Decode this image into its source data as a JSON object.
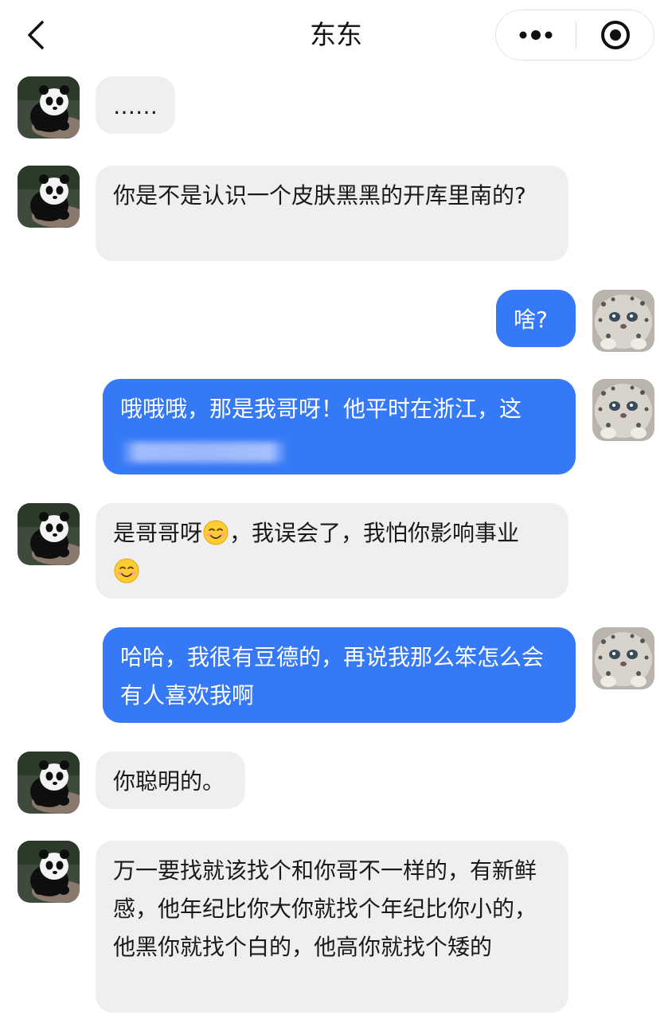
{
  "header": {
    "title": "东东"
  },
  "messages": [
    {
      "side": "in",
      "text": "……"
    },
    {
      "side": "in",
      "text": "你是不是认识一个皮肤黑黑的开库里南的?"
    },
    {
      "side": "out",
      "text": "啥?"
    },
    {
      "side": "out",
      "text": "哦哦哦，那是我哥呀！他平时在浙江，这"
    },
    {
      "side": "in",
      "text_before": "是哥哥呀",
      "text_after": "，我误会了，我怕你影响事业",
      "emoji": "smiling-face-emoji"
    },
    {
      "side": "out",
      "text": "哈哈，我很有豆德的，再说我那么笨怎么会有人喜欢我啊"
    },
    {
      "side": "in",
      "text": "你聪明的。"
    },
    {
      "side": "in",
      "text": "万一要找就该找个和你哥不一样的，有新鲜感，他年纪比你大你就找个年纪比你小的，他黑你就找个白的，他高你就找个矮的"
    }
  ],
  "avatars": {
    "contact": "panda-avatar",
    "self": "snow-leopard-avatar"
  },
  "colors": {
    "incoming_bubble": "#efefef",
    "outgoing_bubble": "#3579f6"
  }
}
